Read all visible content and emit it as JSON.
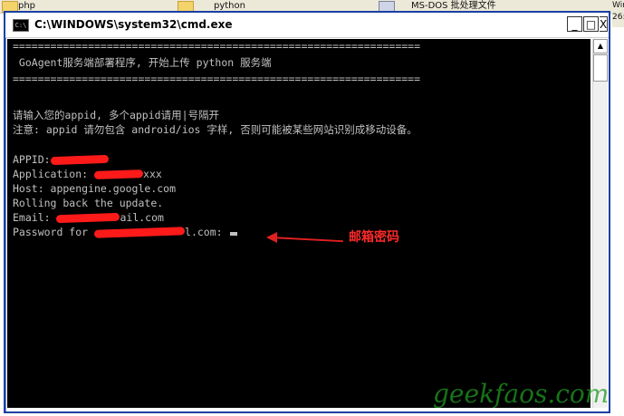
{
  "desktop": {
    "items": [
      "php",
      "python",
      "MS-DOS 批处理文件",
      "Win",
      "26:"
    ]
  },
  "window": {
    "title": "C:\\WINDOWS\\system32\\cmd.exe",
    "icon_label": "C:\\",
    "min_label": "_",
    "max_label": "□",
    "close_label": "X"
  },
  "console": {
    "lines": [
      "=================================================================",
      " GoAgent服务端部署程序, 开始上传 python 服务端",
      "=================================================================",
      "",
      "请输入您的appid, 多个appid请用|号隔开",
      "注意: appid 请勿包含 android/ios 字样, 否则可能被某些网站识别成移动设备。",
      "",
      "APPID:",
      "Application: ",
      "Host: appengine.google.com",
      "Rolling back the update.",
      "Email: ",
      "Password for "
    ],
    "app_suffix": "xxx",
    "email_tail": "ail.com",
    "password_tail": "l.com:"
  },
  "annotation": {
    "label": "邮箱密码",
    "color": "#ff2a2a"
  },
  "watermark": {
    "text": "geekfaos.com",
    "color": "#1f9a1f"
  },
  "colors": {
    "console_bg": "#000000",
    "console_fg": "#c0c0c0",
    "redaction": "#ff1a1a"
  }
}
